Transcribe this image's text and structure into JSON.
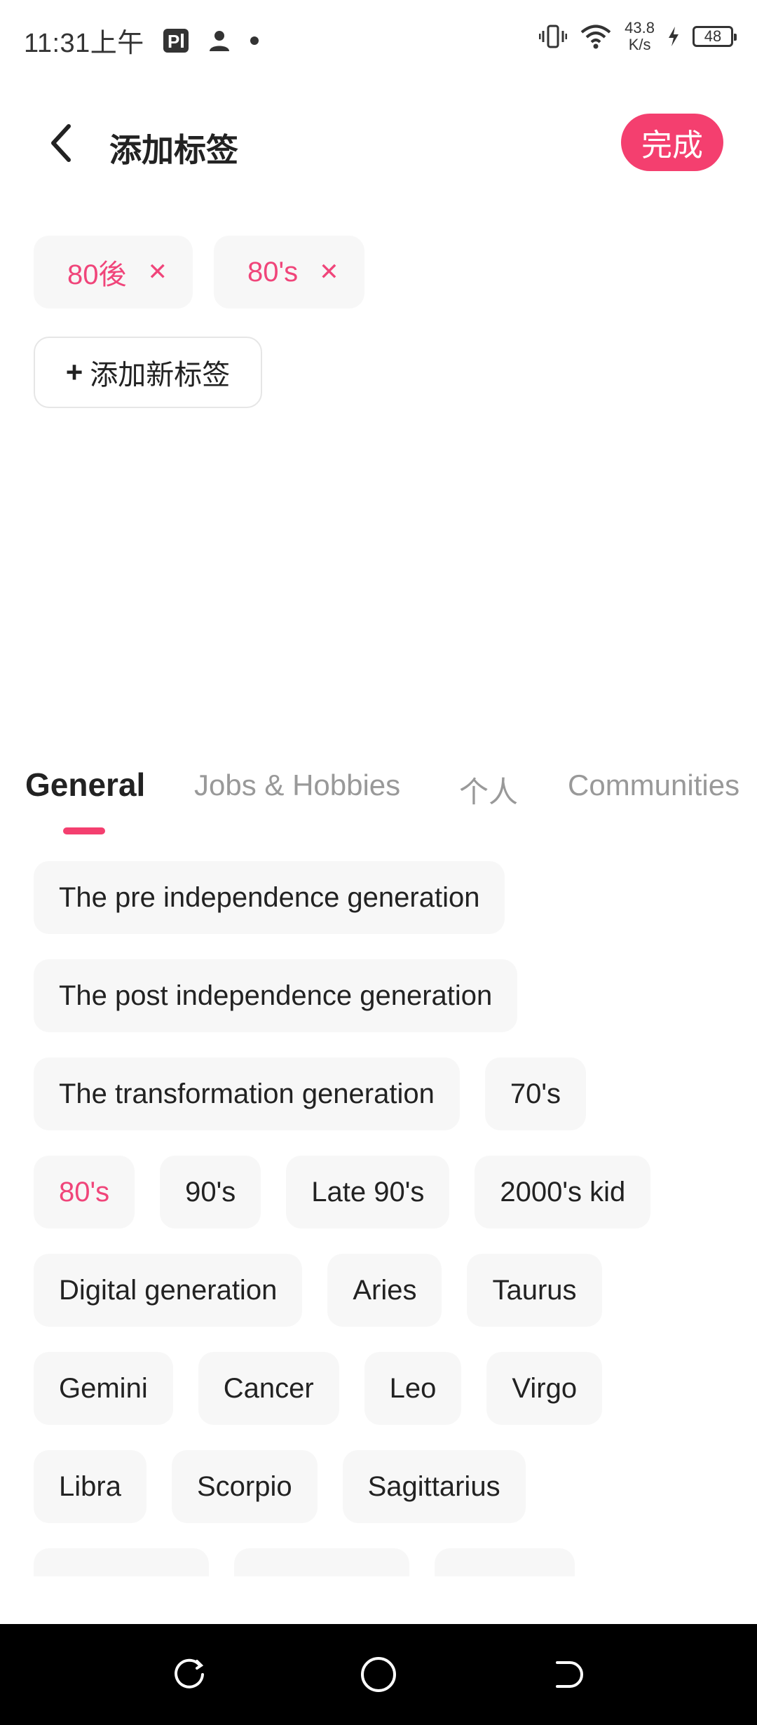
{
  "status": {
    "time": "11:31上午",
    "speed_value": "43.8",
    "speed_unit": "K/s",
    "battery": "48"
  },
  "header": {
    "title": "添加标签",
    "done_label": "完成"
  },
  "selected_tags": [
    {
      "label": "80後"
    },
    {
      "label": "80's"
    }
  ],
  "add_tag": {
    "plus": "+",
    "label": "添加新标签"
  },
  "tabs": [
    {
      "label": "General",
      "active": true
    },
    {
      "label": "Jobs &  Hobbies"
    },
    {
      "label": "个人"
    },
    {
      "label": "Communities"
    }
  ],
  "tag_rows": [
    [
      {
        "label": "The pre independence generation"
      }
    ],
    [
      {
        "label": "The post independence generation"
      }
    ],
    [
      {
        "label": "The transformation generation"
      },
      {
        "label": "70's"
      }
    ],
    [
      {
        "label": "80's",
        "selected": true
      },
      {
        "label": "90's"
      },
      {
        "label": "Late 90's"
      },
      {
        "label": "2000's kid"
      }
    ],
    [
      {
        "label": "Digital generation"
      },
      {
        "label": "Aries"
      },
      {
        "label": "Taurus"
      }
    ],
    [
      {
        "label": "Gemini"
      },
      {
        "label": "Cancer"
      },
      {
        "label": "Leo"
      },
      {
        "label": "Virgo"
      }
    ],
    [
      {
        "label": "Libra"
      },
      {
        "label": "Scorpio"
      },
      {
        "label": "Sagittarius"
      }
    ]
  ],
  "colors": {
    "accent": "#f43f6f",
    "selected_text": "#f0457a",
    "chip_bg": "#f7f7f7"
  }
}
